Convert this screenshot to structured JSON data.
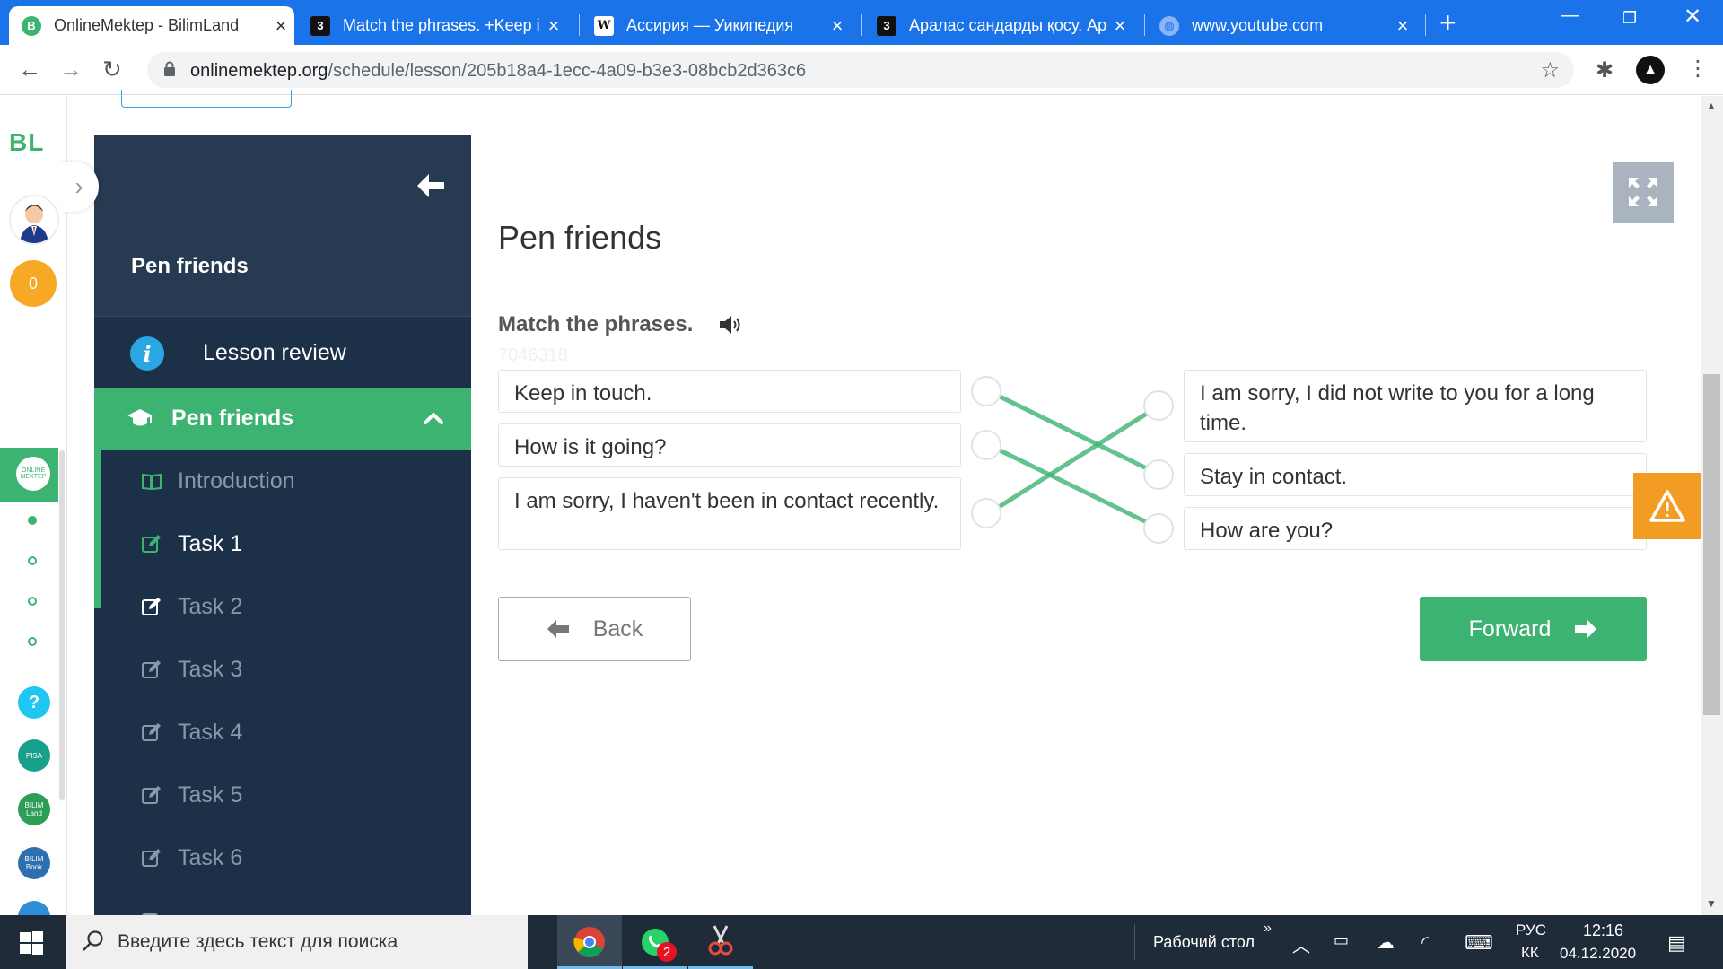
{
  "browser": {
    "tabs": [
      {
        "title": "OnlineMektep - BilimLand",
        "favicon": "bilimland-favicon",
        "active": true
      },
      {
        "title": "Match the phrases. +Keep i",
        "favicon": "z-favicon"
      },
      {
        "title": "Ассирия — Уикипедия",
        "favicon": "wikipedia-favicon"
      },
      {
        "title": "Аралас сандарды қосу. Ар",
        "favicon": "z-favicon"
      },
      {
        "title": "www.youtube.com",
        "favicon": "globe-favicon"
      }
    ],
    "url_domain": "onlinemektep.org",
    "url_path": "/schedule/lesson/205b18a4-1ecc-4a09-b3e3-08bcb2d363c6"
  },
  "rail": {
    "logo": "BL",
    "coins": "0",
    "active_app_label": "ONLINE MEKTEP",
    "apps": [
      "?",
      "PISA",
      "BILIM Land",
      "BILIM Book"
    ]
  },
  "sidebar": {
    "title": "Pen friends",
    "lesson_review": "Lesson review",
    "section": "Pen friends",
    "items": [
      {
        "label": "Introduction",
        "icon": "book-icon"
      },
      {
        "label": "Task 1",
        "icon": "edit-icon",
        "current": true
      },
      {
        "label": "Task 2",
        "icon": "edit-icon"
      },
      {
        "label": "Task 3",
        "icon": "edit-icon"
      },
      {
        "label": "Task 4",
        "icon": "edit-icon"
      },
      {
        "label": "Task 5",
        "icon": "edit-icon"
      },
      {
        "label": "Task 6",
        "icon": "edit-icon"
      }
    ]
  },
  "main": {
    "title": "Pen friends",
    "instruction": "Match the phrases.",
    "faint_code": "7046318",
    "left_phrases": [
      "Keep in touch.",
      "How is it going?",
      "I am sorry, I haven't been in contact recently."
    ],
    "right_phrases": [
      "I am sorry, I did not write to you for a long time.",
      "Stay in contact.",
      "How are you?"
    ],
    "matches": [
      [
        0,
        1
      ],
      [
        1,
        2
      ],
      [
        2,
        0
      ]
    ],
    "back_label": "Back",
    "forward_label": "Forward"
  },
  "taskbar": {
    "search_placeholder": "Введите здесь текст для поиска",
    "whatsapp_badge": "2",
    "desktop_label": "Рабочий стол",
    "lang_top": "РУС",
    "lang_bottom": "КК",
    "time": "12:16",
    "date": "04.12.2020"
  },
  "colors": {
    "accent_green": "#3cb371",
    "sidebar_bg": "#1c3048",
    "chrome_blue": "#1a73e8",
    "warning_orange": "#f39c24"
  }
}
